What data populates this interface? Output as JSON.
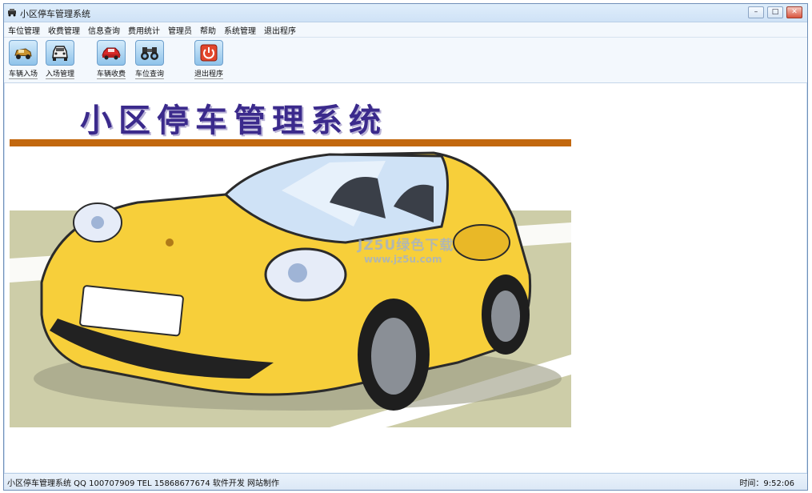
{
  "window": {
    "title": "小区停车管理系统"
  },
  "menu": {
    "items": [
      "车位管理",
      "收费管理",
      "信息查询",
      "费用统计",
      "管理员",
      "帮助",
      "系统管理",
      "退出程序"
    ]
  },
  "toolbar": {
    "buttons": [
      {
        "label": "车辆入场",
        "icon": "car-enter-icon"
      },
      {
        "label": "入场管理",
        "icon": "car-front-icon"
      },
      {
        "label": "车辆收费",
        "icon": "red-car-icon"
      },
      {
        "label": "车位查询",
        "icon": "binoculars-icon"
      },
      {
        "label": "退出程序",
        "icon": "power-icon"
      }
    ]
  },
  "banner": {
    "title": "小区停车管理系统"
  },
  "watermark": {
    "line1": "JZ5U绿色下载",
    "line2": "www.jz5u.com"
  },
  "statusbar": {
    "left": "小区停车管理系统   QQ 100707909   TEL 15868677674   软件开发  网站制作",
    "right": "时间：9:52:06"
  },
  "colors": {
    "banner_title": "#3b2a8c",
    "stripe": "#c2680f",
    "car_body": "#f7cf3a",
    "road": "#c9c9a6"
  }
}
